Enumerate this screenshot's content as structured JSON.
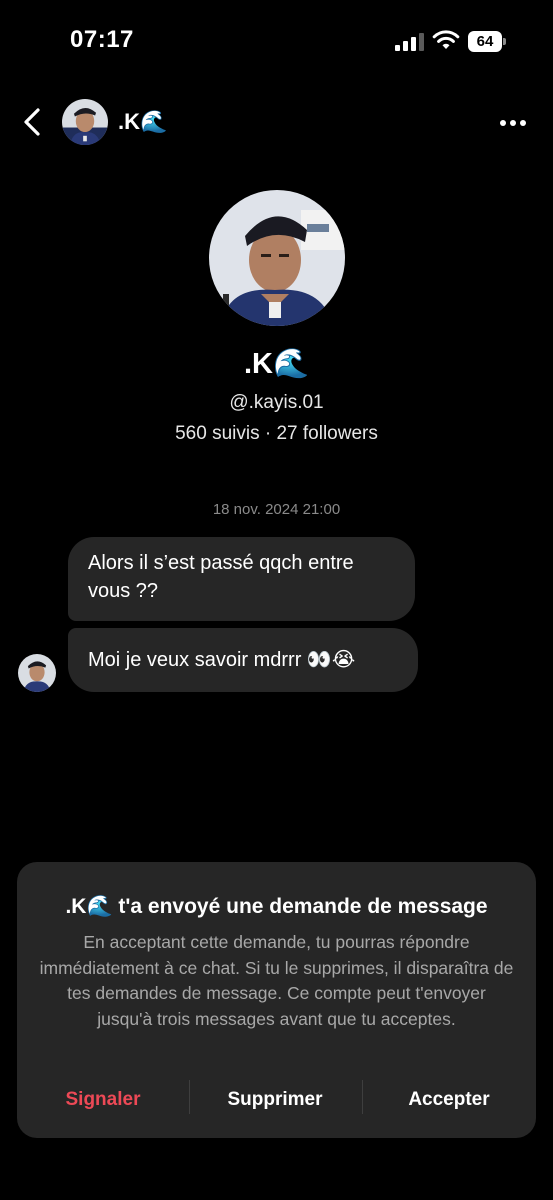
{
  "status_bar": {
    "time": "07:17",
    "battery": "64"
  },
  "header": {
    "name": ".K🌊",
    "back_icon": "chevron-left-icon",
    "more_icon": "more-horizontal-icon"
  },
  "profile": {
    "name": ".K🌊",
    "handle": "@.kayis.01",
    "stats": "560 suivis · 27 followers"
  },
  "conversation": {
    "timestamp": "18 nov. 2024 21:00",
    "messages": [
      {
        "text": "Alors il s’est passé qqch entre vous ??"
      },
      {
        "text": "Moi je veux savoir mdrrr 👀😭"
      }
    ]
  },
  "request_card": {
    "title": ".K🌊 t'a envoyé une demande de message",
    "body": "En acceptant cette demande, tu pourras répondre immédiatement à ce chat. Si tu le supprimes, il disparaîtra de tes demandes de message. Ce compte peut t'envoyer jusqu'à trois messages avant que tu acceptes.",
    "report_label": "Signaler",
    "delete_label": "Supprimer",
    "accept_label": "Accepter"
  },
  "colors": {
    "background": "#000000",
    "bubble": "#262626",
    "card": "#262626",
    "danger": "#ed4956",
    "muted_text": "#a8a8a8"
  }
}
